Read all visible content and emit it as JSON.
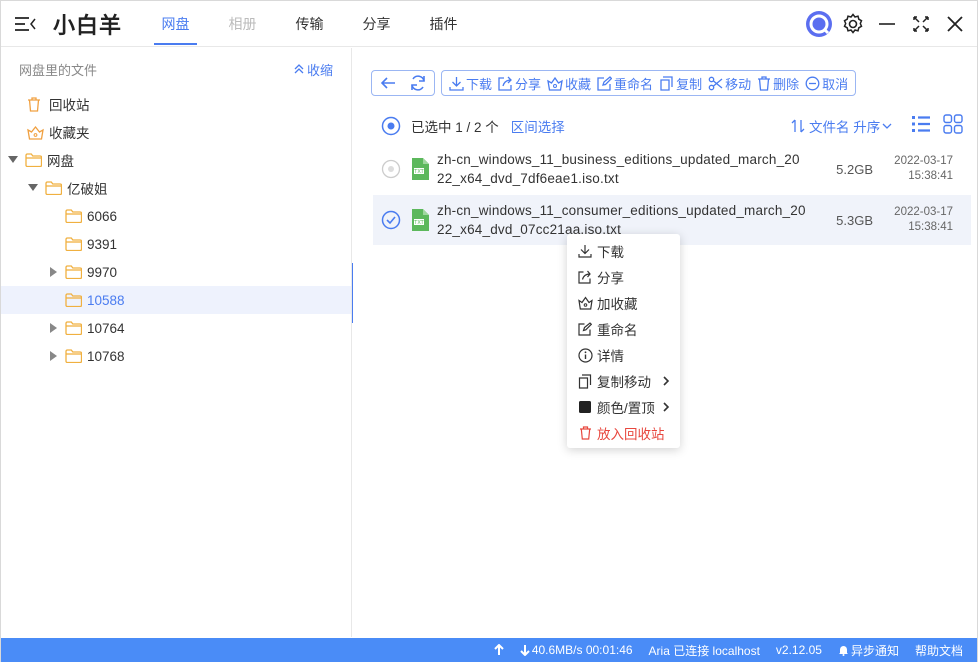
{
  "app": {
    "brand": "小白羊"
  },
  "nav": {
    "tabs": [
      {
        "label": "网盘",
        "state": "active"
      },
      {
        "label": "相册",
        "state": "disabled"
      },
      {
        "label": "传输",
        "state": "normal"
      },
      {
        "label": "分享",
        "state": "normal"
      },
      {
        "label": "插件",
        "state": "normal"
      }
    ]
  },
  "header_icons": [
    "app-logo-icon",
    "settings-icon",
    "minimize-icon",
    "maximize-icon",
    "close-icon"
  ],
  "sidebar": {
    "title": "网盘里的文件",
    "collapse_label": "收缩",
    "tree": [
      {
        "label": "回收站",
        "icon": "trash-icon",
        "level": 0,
        "arrow": "none"
      },
      {
        "label": "收藏夹",
        "icon": "favorite-icon",
        "level": 0,
        "arrow": "none"
      },
      {
        "label": "网盘",
        "icon": "folder-icon",
        "level": 0,
        "arrow": "expanded"
      },
      {
        "label": "亿破姐",
        "icon": "folder-icon",
        "level": 1,
        "arrow": "expanded"
      },
      {
        "label": "6066",
        "icon": "folder-icon",
        "level": 2,
        "arrow": "none"
      },
      {
        "label": "9391",
        "icon": "folder-icon",
        "level": 2,
        "arrow": "none"
      },
      {
        "label": "9970",
        "icon": "folder-icon",
        "level": 2,
        "arrow": "collapsed"
      },
      {
        "label": "10588",
        "icon": "folder-icon",
        "level": 2,
        "arrow": "none",
        "selected": true
      },
      {
        "label": "10764",
        "icon": "folder-icon",
        "level": 2,
        "arrow": "collapsed"
      },
      {
        "label": "10768",
        "icon": "folder-icon",
        "level": 2,
        "arrow": "collapsed"
      }
    ]
  },
  "toolbar": {
    "download": "下载",
    "share": "分享",
    "favorite": "收藏",
    "rename": "重命名",
    "copy": "复制",
    "move": "移动",
    "delete": "删除",
    "cancel": "取消"
  },
  "selection": {
    "label": "已选中 1 / 2 个",
    "range_select": "区间选择",
    "sort_label": "文件名 升序"
  },
  "files": [
    {
      "name": "zh-cn_windows_11_business_editions_updated_march_2022_x64_dvd_7df6eae1.iso.txt",
      "size": "5.2GB",
      "date": "2022-03-17",
      "time": "15:38:41",
      "selected": false
    },
    {
      "name": "zh-cn_windows_11_consumer_editions_updated_march_2022_x64_dvd_07cc21aa.iso.txt",
      "size": "5.3GB",
      "date": "2022-03-17",
      "time": "15:38:41",
      "selected": true
    }
  ],
  "context_menu": {
    "items": [
      {
        "label": "下载",
        "icon": "download-icon"
      },
      {
        "label": "分享",
        "icon": "share-icon"
      },
      {
        "label": "加收藏",
        "icon": "favorite-icon"
      },
      {
        "label": "重命名",
        "icon": "rename-icon"
      },
      {
        "label": "详情",
        "icon": "info-icon"
      },
      {
        "label": "复制移动",
        "icon": "copy-icon",
        "submenu": true
      },
      {
        "label": "颜色/置顶",
        "icon": "color-square-icon",
        "submenu": true
      },
      {
        "label": "放入回收站",
        "icon": "trash-icon",
        "danger": true
      }
    ]
  },
  "footer": {
    "speed": "40.6MB/s 00:01:46",
    "aria": "Aria 已连接 localhost",
    "version": "v2.12.05",
    "notify": "异步通知",
    "help": "帮助文档"
  },
  "colors": {
    "accent": "#4a7cf0",
    "footer_bg": "#4a8cf7",
    "folder": "#f0b040",
    "danger": "#e8473e",
    "txt_file": "#5cb85c"
  }
}
